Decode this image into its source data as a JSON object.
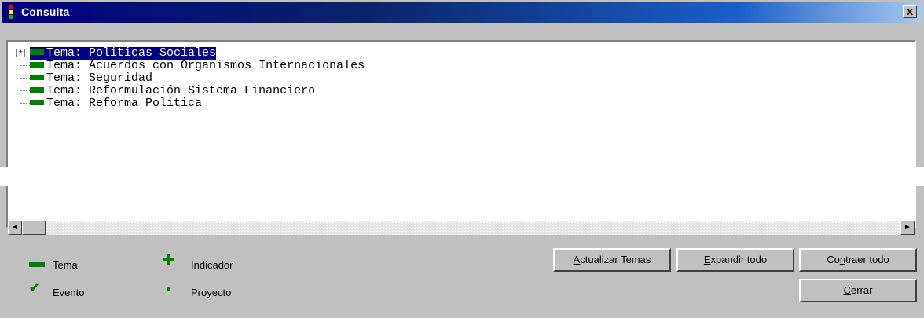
{
  "window": {
    "title": "Consulta",
    "close_label": "x"
  },
  "tree": {
    "items": [
      {
        "prefix": "Tema:",
        "label": "Politicas Sociales",
        "selected": true,
        "expandable": true
      },
      {
        "prefix": "Tema:",
        "label": "Acuerdos con Organismos Internacionales",
        "selected": false,
        "expandable": false
      },
      {
        "prefix": "Tema:",
        "label": "Seguridad",
        "selected": false,
        "expandable": false
      },
      {
        "prefix": "Tema:",
        "label": "Reformulación Sistema Financiero",
        "selected": false,
        "expandable": false
      },
      {
        "prefix": "Tema:",
        "label": "Reforma Politica",
        "selected": false,
        "expandable": false
      }
    ],
    "expander_symbol": "+"
  },
  "scrollbar": {
    "left_arrow": "◄",
    "right_arrow": "►"
  },
  "legend": {
    "tema": "Tema",
    "indicador": "Indicador",
    "evento": "Evento",
    "proyecto": "Proyecto"
  },
  "buttons": {
    "actualizar": {
      "u": "A",
      "rest": "ctualizar Temas"
    },
    "expandir": {
      "u": "E",
      "rest": "xpandir todo"
    },
    "contraer": {
      "pre": "Co",
      "u": "n",
      "rest": "traer todo"
    },
    "cerrar": {
      "u": "C",
      "rest": "errar"
    }
  },
  "colors": {
    "title_gradient_start": "#000080",
    "title_gradient_end": "#a6caf0",
    "selection": "#000080",
    "tema_icon": "#008000",
    "face": "#c0c0c0"
  }
}
